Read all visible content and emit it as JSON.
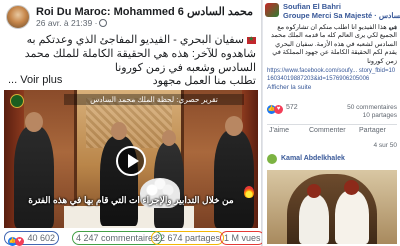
{
  "left_post": {
    "page_name": "Roi Du Maroc: Mohammed 6 محمد السادس",
    "timestamp": "26 avr. à 21:39 ·",
    "caption": "سفيان البحري - الفيديو المفاجئ الذي وعدتكم به شاهدوه للآخر: هذه هي الحقيقة الكاملة للملك محمد السادس وشعبه في زمن كورونا",
    "see_more_ar": "تطلب منا العمل مجهود",
    "see_more_label": "... Voir plus",
    "video": {
      "overlay_title": "تقرير حصري: لحظة الملك محمد السادس",
      "subtitle": "من خلال التدابير والإجراء ات التي قام بها في هذه الفترة"
    },
    "stats": {
      "likes": "40 602",
      "comments": "4 247 commentaires",
      "shares": "22 674 partages",
      "views": "1 M vues"
    }
  },
  "right_panel": {
    "author_name": "Soufian El Bahri",
    "group_name": "Groupe Merci Sa Majesté · السادس",
    "post_text": "في هذا الفيديو أنا أطلب منكم أن تشاركوه مع الجميع لكي يرى العالم كله ما قدمه الملك محمد السادس لشعبه في هذه الأزمة. سفيان البحري يقدم لكم الحقيقة الكاملة عن جهود المملكة في زمن كورونا",
    "link": "https://www.facebook.com/soufy... story_fbid=1016034019887203&id=1576906205006",
    "show_more": "Afficher la suite",
    "likes": "572",
    "comments": "50 commentaires",
    "shares": "10 partages",
    "actions": [
      "J'aime",
      "Commenter",
      "Partager"
    ],
    "pager": "4 sur 50",
    "comment_author": "Kamal Abdelkhalek"
  }
}
